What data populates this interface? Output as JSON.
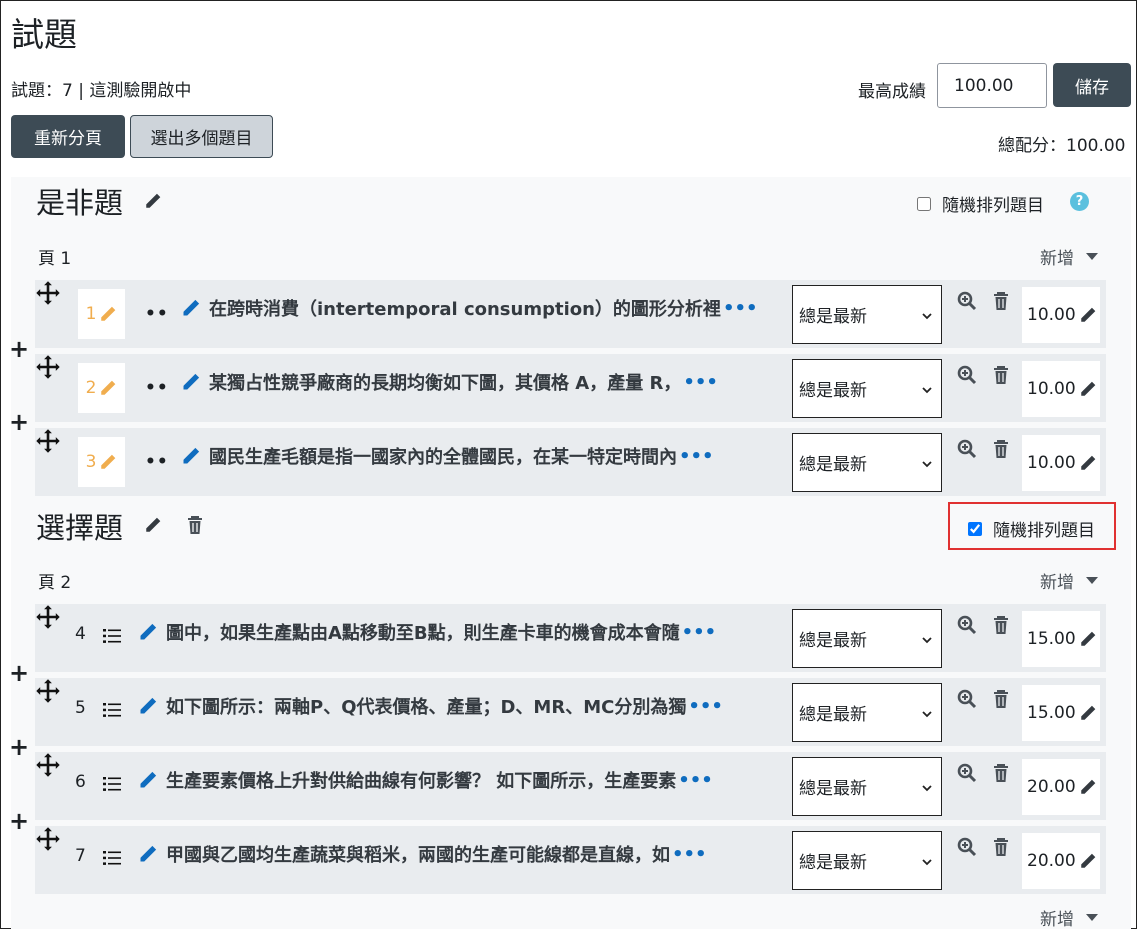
{
  "page_title": "試題",
  "info_text": "試題：7 | 這測驗開啟中",
  "max_grade": {
    "label": "最高成績",
    "value": "100.00",
    "save_label": "儲存"
  },
  "buttons": {
    "repaginate": "重新分頁",
    "select_multiple": "選出多個題目"
  },
  "total_marks": "總配分：100.00",
  "sections": [
    {
      "title": "是非題",
      "shuffle_label": "隨機排列題目",
      "shuffle_checked": false,
      "page_label": "頁 1",
      "add_label": "新增",
      "questions": [
        {
          "number": "1",
          "text": "在跨時消費（intertemporal consumption）的圖形分析裡",
          "version": "總是最新",
          "mark": "10.00"
        },
        {
          "number": "2",
          "text": "某獨占性競爭廠商的長期均衡如下圖，其價格 A，產量 R，",
          "version": "總是最新",
          "mark": "10.00"
        },
        {
          "number": "3",
          "text": "國民生產毛額是指一國家內的全體國民，在某一特定時間內",
          "version": "總是最新",
          "mark": "10.00"
        }
      ]
    },
    {
      "title": "選擇題",
      "shuffle_label": "隨機排列題目",
      "shuffle_checked": true,
      "page_label": "頁 2",
      "add_label": "新增",
      "questions": [
        {
          "number": "4",
          "text": "圖中，如果生產點由A點移動至B點，則生產卡車的機會成本會隨",
          "version": "總是最新",
          "mark": "15.00"
        },
        {
          "number": "5",
          "text": "如下圖所示：兩軸P、Q代表價格、產量；D、MR、MC分別為獨",
          "version": "總是最新",
          "mark": "15.00"
        },
        {
          "number": "6",
          "text": "生產要素價格上升對供給曲線有何影響？ 如下圖所示，生產要素",
          "version": "總是最新",
          "mark": "20.00"
        },
        {
          "number": "7",
          "text": "甲國與乙國均生產蔬菜與稻米，兩國的生產可能線都是直線，如",
          "version": "總是最新",
          "mark": "20.00"
        }
      ],
      "footer_add_label": "新增"
    }
  ],
  "ellipsis": "•••",
  "dots": "••",
  "plus": "+",
  "help_glyph": "?",
  "colors": {
    "button_dark": "#3d4b55",
    "link_blue": "#0f6cbf",
    "pencil_yellow": "#f0ad4e",
    "highlight_red": "#e03131"
  }
}
